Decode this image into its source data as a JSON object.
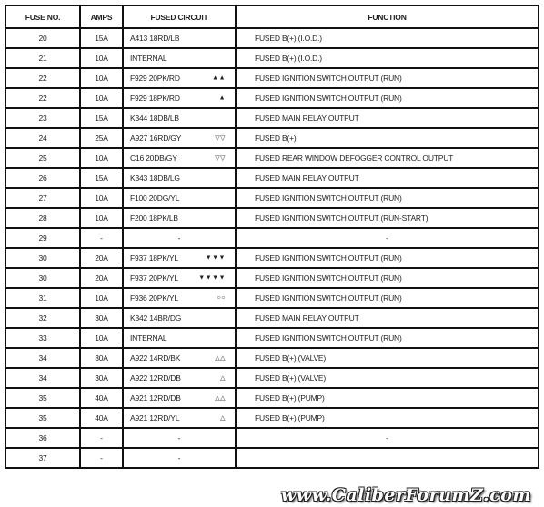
{
  "headers": {
    "fuse_no": "FUSE NO.",
    "amps": "AMPS",
    "circuit": "FUSED CIRCUIT",
    "function": "FUNCTION"
  },
  "rows": [
    {
      "fuse": "20",
      "amps": "15A",
      "circuit": "A413 18RD/LB",
      "symbol": "",
      "function": "FUSED B(+) (I.O.D.)"
    },
    {
      "fuse": "21",
      "amps": "10A",
      "circuit": "INTERNAL",
      "symbol": "",
      "function": "FUSED B(+) (I.O.D.)"
    },
    {
      "fuse": "22",
      "amps": "10A",
      "circuit": "F929 20PK/RD",
      "symbol": "▲▲",
      "function": "FUSED IGNITION SWITCH OUTPUT (RUN)"
    },
    {
      "fuse": "22",
      "amps": "10A",
      "circuit": "F929 18PK/RD",
      "symbol": "▲",
      "function": "FUSED IGNITION SWITCH OUTPUT (RUN)"
    },
    {
      "fuse": "23",
      "amps": "15A",
      "circuit": "K344 18DB/LB",
      "symbol": "",
      "function": "FUSED MAIN RELAY OUTPUT"
    },
    {
      "fuse": "24",
      "amps": "25A",
      "circuit": "A927 16RD/GY",
      "symbol": "▽▽",
      "function": "FUSED B(+)"
    },
    {
      "fuse": "25",
      "amps": "10A",
      "circuit": "C16 20DB/GY",
      "symbol": "▽▽",
      "function": "FUSED REAR WINDOW DEFOGGER CONTROL OUTPUT"
    },
    {
      "fuse": "26",
      "amps": "15A",
      "circuit": "K343 18DB/LG",
      "symbol": "",
      "function": "FUSED MAIN RELAY OUTPUT"
    },
    {
      "fuse": "27",
      "amps": "10A",
      "circuit": "F100 20DG/YL",
      "symbol": "",
      "function": "FUSED IGNITION SWITCH OUTPUT (RUN)"
    },
    {
      "fuse": "28",
      "amps": "10A",
      "circuit": "F200 18PK/LB",
      "symbol": "",
      "function": "FUSED IGNITION SWITCH OUTPUT (RUN-START)"
    },
    {
      "fuse": "29",
      "amps": "-",
      "circuit": "-",
      "symbol": "",
      "function": "-"
    },
    {
      "fuse": "30",
      "amps": "20A",
      "circuit": "F937 18PK/YL",
      "symbol": "▼▼▼",
      "function": "FUSED IGNITION SWITCH OUTPUT (RUN)"
    },
    {
      "fuse": "30",
      "amps": "20A",
      "circuit": "F937 20PK/YL",
      "symbol": "▼▼▼▼",
      "function": "FUSED IGNITION SWITCH OUTPUT (RUN)"
    },
    {
      "fuse": "31",
      "amps": "10A",
      "circuit": "F936 20PK/YL",
      "symbol": "○○",
      "function": "FUSED IGNITION SWITCH OUTPUT (RUN)"
    },
    {
      "fuse": "32",
      "amps": "30A",
      "circuit": "K342 14BR/DG",
      "symbol": "",
      "function": "FUSED MAIN RELAY OUTPUT"
    },
    {
      "fuse": "33",
      "amps": "10A",
      "circuit": "INTERNAL",
      "symbol": "",
      "function": "FUSED IGNITION SWITCH OUTPUT (RUN)"
    },
    {
      "fuse": "34",
      "amps": "30A",
      "circuit": "A922 14RD/BK",
      "symbol": "△△",
      "function": "FUSED B(+) (VALVE)"
    },
    {
      "fuse": "34",
      "amps": "30A",
      "circuit": "A922 12RD/DB",
      "symbol": "△",
      "function": "FUSED B(+) (VALVE)"
    },
    {
      "fuse": "35",
      "amps": "40A",
      "circuit": "A921 12RD/DB",
      "symbol": "△△",
      "function": "FUSED B(+) (PUMP)"
    },
    {
      "fuse": "35",
      "amps": "40A",
      "circuit": "A921 12RD/YL",
      "symbol": "△",
      "function": "FUSED B(+) (PUMP)"
    },
    {
      "fuse": "36",
      "amps": "-",
      "circuit": "-",
      "symbol": "",
      "function": "-"
    },
    {
      "fuse": "37",
      "amps": "-",
      "circuit": "-",
      "symbol": "",
      "function": ""
    }
  ],
  "watermark": "www.CaliberForumZ.com"
}
